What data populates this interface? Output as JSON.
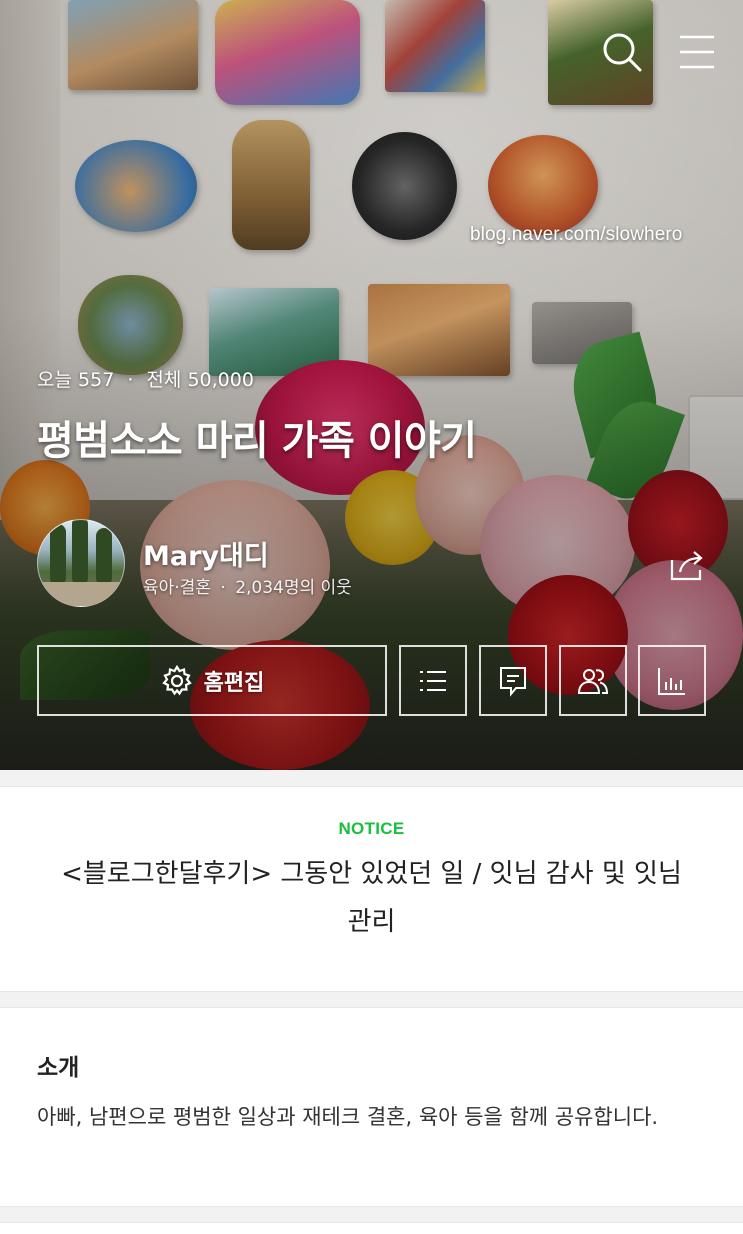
{
  "header": {
    "blog_url": "blog.naver.com/slowhero",
    "icons": {
      "search": "search-icon",
      "menu": "hamburger-menu-icon"
    }
  },
  "blog": {
    "today_label": "오늘",
    "today_count": "557",
    "total_label": "전체",
    "total_count": "50,000",
    "title": "평범소소 마리 가족 이야기",
    "nickname": "Mary대디",
    "category": "육아·결혼",
    "neighbors": "2,034명의 이웃"
  },
  "actions": {
    "home_edit_label": "홈편집",
    "icons": [
      "gear-icon",
      "list-icon",
      "comment-icon",
      "neighbors-icon",
      "stats-icon",
      "share-icon"
    ]
  },
  "notice": {
    "tag": "NOTICE",
    "title": "<블로그한달후기> 그동안 있었던 일 / 잇님 감사 및 잇님 관리"
  },
  "intro": {
    "heading": "소개",
    "text": "아빠, 남편으로 평범한 일상과 재테크 결혼, 육아 등을 함께 공유합니다."
  },
  "colors": {
    "notice_green": "#19bf3e",
    "card_bg": "#ffffff",
    "page_bg": "#f2f2f2"
  }
}
